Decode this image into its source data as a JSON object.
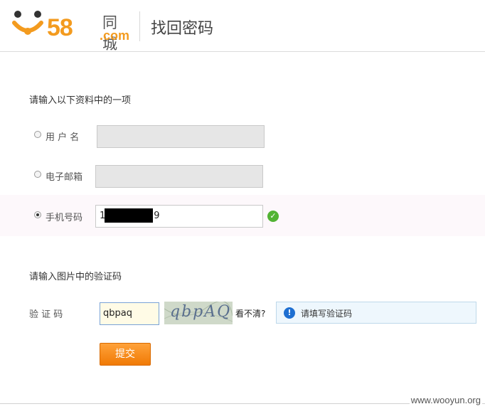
{
  "header": {
    "logo_number": "58",
    "logo_cn": "同城",
    "logo_com": ".com",
    "page_title": "找回密码"
  },
  "form": {
    "section1_label": "请输入以下资料中的一项",
    "options": [
      {
        "label": "用 户 名",
        "value": "",
        "checked": false
      },
      {
        "label": "电子邮箱",
        "value": "",
        "checked": false
      },
      {
        "label": "手机号码",
        "value_prefix": "1",
        "value_suffix": "9",
        "checked": true
      }
    ],
    "section2_label": "请输入图片中的验证码",
    "captcha_label": "验 证 码",
    "captcha_value": "qbpaq",
    "captcha_image_text": "qbpAQ",
    "captcha_refresh": "看不清?",
    "captcha_tip": "请填写验证码",
    "submit_label": "提交"
  },
  "watermark": "www.wooyun.org",
  "colors": {
    "brand_orange": "#f39b1f",
    "button_orange": "#f07a05",
    "success_green": "#52b334",
    "info_blue": "#1f6fd1"
  }
}
